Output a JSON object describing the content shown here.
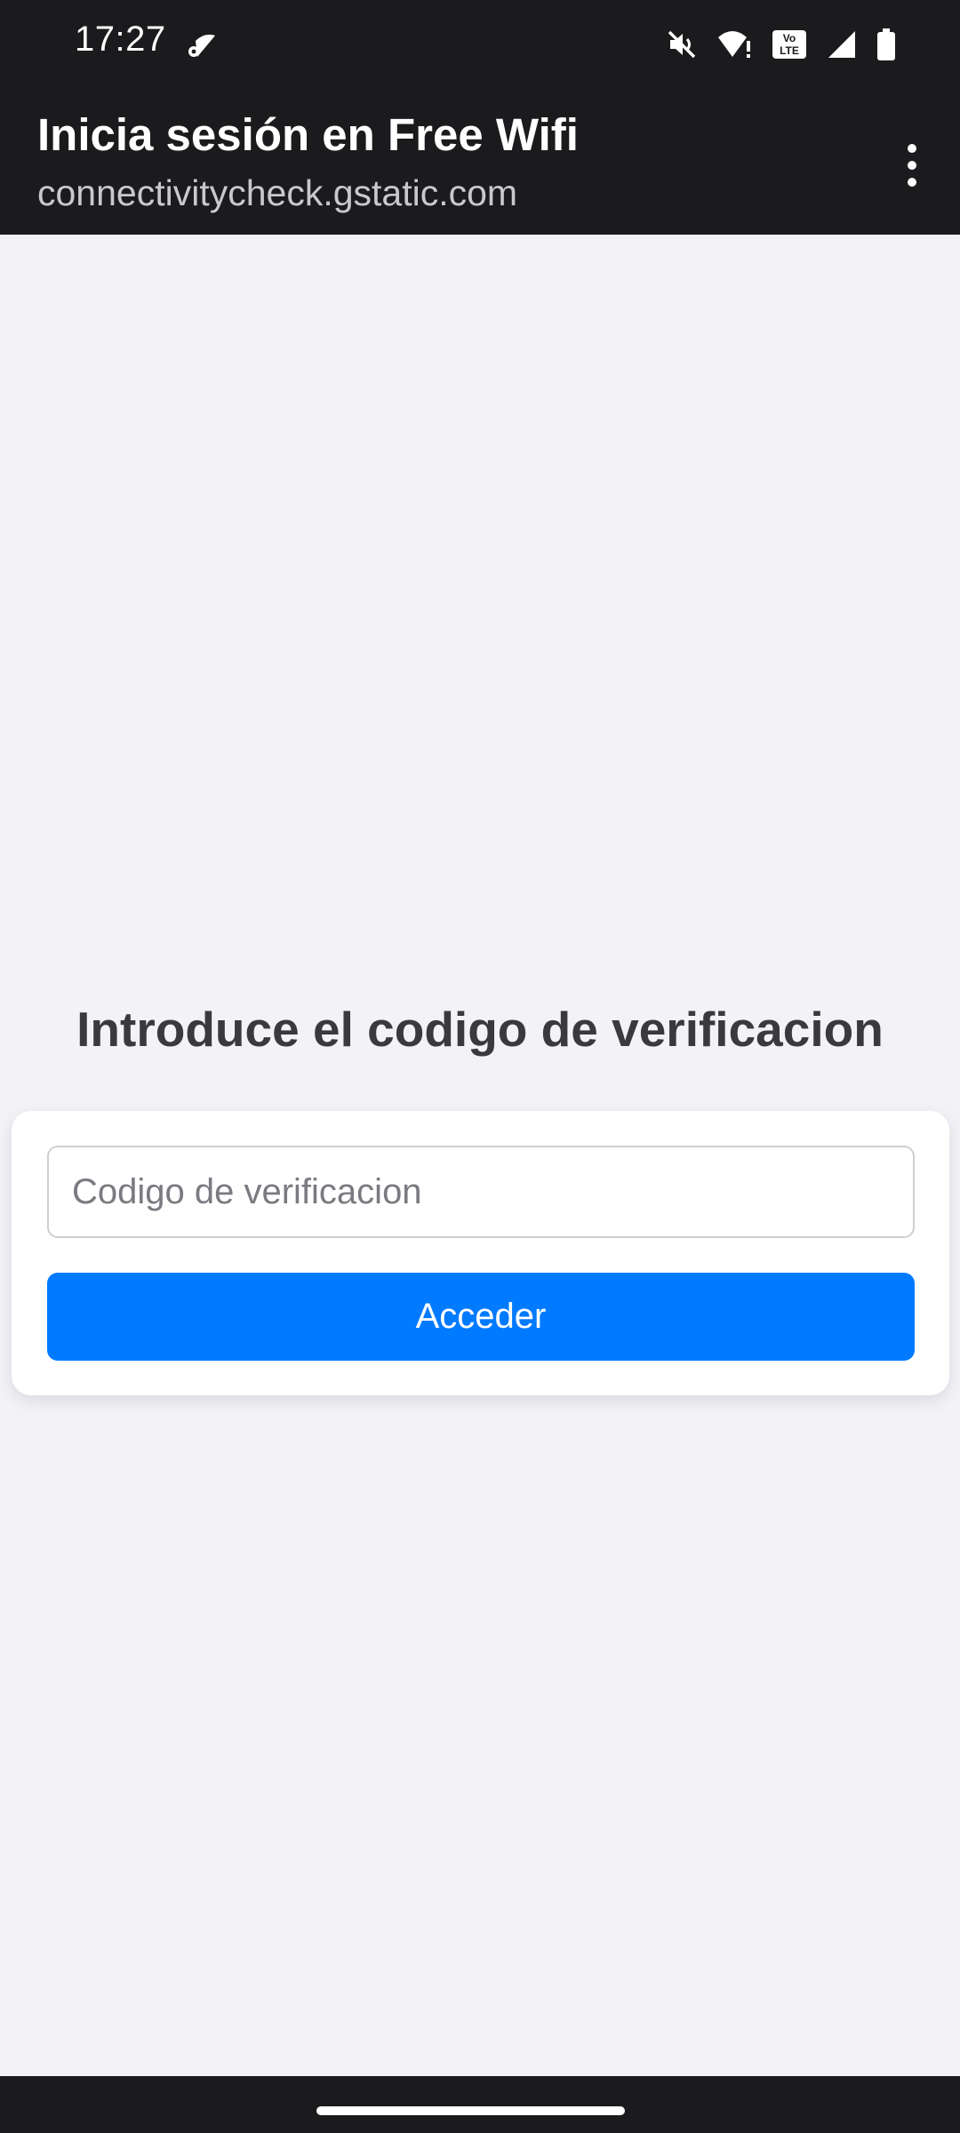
{
  "status_bar": {
    "time": "17:27",
    "icons": [
      "wifi-settings-icon",
      "mute-icon",
      "wifi-warning-icon",
      "volte-icon",
      "signal-icon",
      "battery-icon"
    ],
    "volte_label": "Vo\nLTE"
  },
  "app_bar": {
    "title": "Inicia sesión en Free Wifi",
    "url": "connectivitycheck.gstatic.com",
    "menu_icon": "more-vert-icon"
  },
  "main": {
    "heading": "Introduce el codigo de verificacion",
    "code_input": {
      "value": "",
      "placeholder": "Codigo de verificacion"
    },
    "submit_label": "Acceder"
  },
  "colors": {
    "system_bar": "#1b1b1d",
    "background": "#f2f2f7",
    "accent": "#007aff",
    "heading": "#3a3a3c"
  }
}
